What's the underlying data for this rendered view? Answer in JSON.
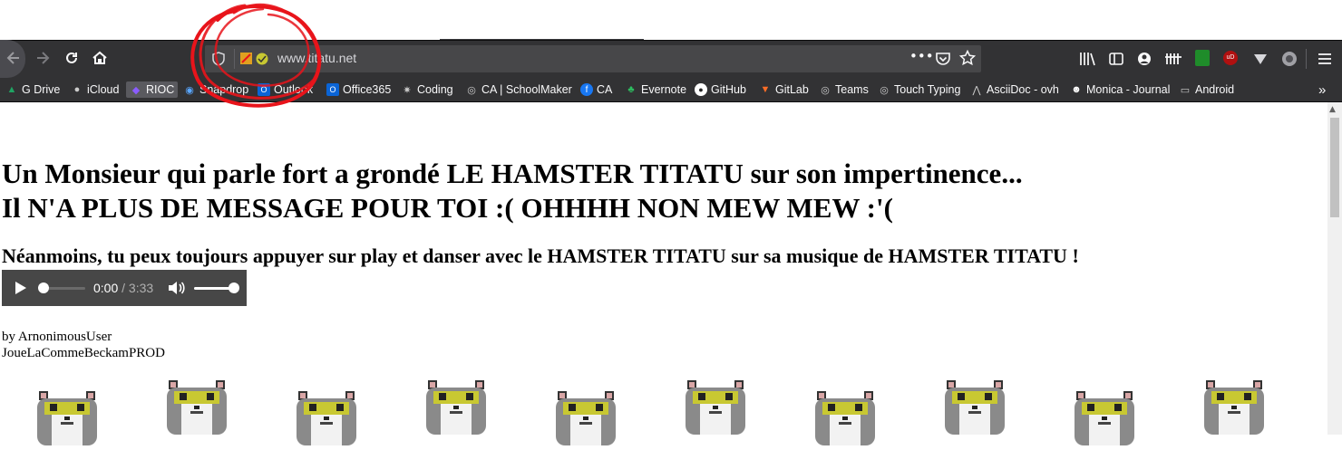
{
  "browser": {
    "url": "www.titatu.net",
    "bookmarks": [
      {
        "label": "G Drive",
        "icon": "google-drive-icon",
        "color": "#1fa463"
      },
      {
        "label": "iCloud",
        "icon": "apple-icon",
        "color": "#cccccc"
      },
      {
        "label": "RIOC",
        "icon": "space-invader-icon",
        "color": "#8a5cff"
      },
      {
        "label": "Snapdrop",
        "icon": "snapdrop-icon",
        "color": "#59a6ff"
      },
      {
        "label": "Outlook",
        "icon": "outlook-icon",
        "color": "#0a64d6"
      },
      {
        "label": "Office365",
        "icon": "office-icon",
        "color": "#0a64d6"
      },
      {
        "label": "Coding",
        "icon": "sparkle-icon",
        "color": "#cccccc"
      },
      {
        "label": "CA | SchoolMaker",
        "icon": "globe-icon",
        "color": "#cccccc"
      },
      {
        "label": "CA",
        "icon": "facebook-icon",
        "color": "#1877f2"
      },
      {
        "label": "Evernote",
        "icon": "evernote-icon",
        "color": "#2dbe60"
      },
      {
        "label": "GitHub",
        "icon": "github-icon",
        "color": "#ffffff"
      },
      {
        "label": "GitLab",
        "icon": "gitlab-icon",
        "color": "#fc6d26"
      },
      {
        "label": "Teams",
        "icon": "globe-icon",
        "color": "#cccccc"
      },
      {
        "label": "Touch Typing",
        "icon": "globe-icon",
        "color": "#cccccc"
      },
      {
        "label": "AsciiDoc - ovh",
        "icon": "asciidoc-icon",
        "color": "#cccccc"
      },
      {
        "label": "Monica - Journal",
        "icon": "monica-icon",
        "color": "#ffffff"
      },
      {
        "label": "Android",
        "icon": "folder-icon",
        "color": "#cccccc"
      }
    ]
  },
  "page": {
    "heading_line1": "Un Monsieur qui parle fort a grondé LE HAMSTER TITATU sur son impertinence...",
    "heading_line2": "Il N'A PLUS DE MESSAGE POUR TOI :( OHHHH NON MEW MEW :'(",
    "subheading": "Néanmoins, tu peux toujours appuyer sur play et danser avec le HAMSTER TITATU sur sa musique de HAMSTER TITATU !",
    "audio": {
      "current_time": "0:00",
      "separator": " / ",
      "duration": "3:33",
      "progress": 0.0,
      "volume": 1.0
    },
    "credit_line1": "by ArnonimousUser",
    "credit_line2": "JoueLaCommeBeckamPROD",
    "hamster_count": 10
  },
  "colors": {
    "toolbar": "#323234",
    "annotation": "#e8141b",
    "hamster_green": "#c8c832"
  }
}
